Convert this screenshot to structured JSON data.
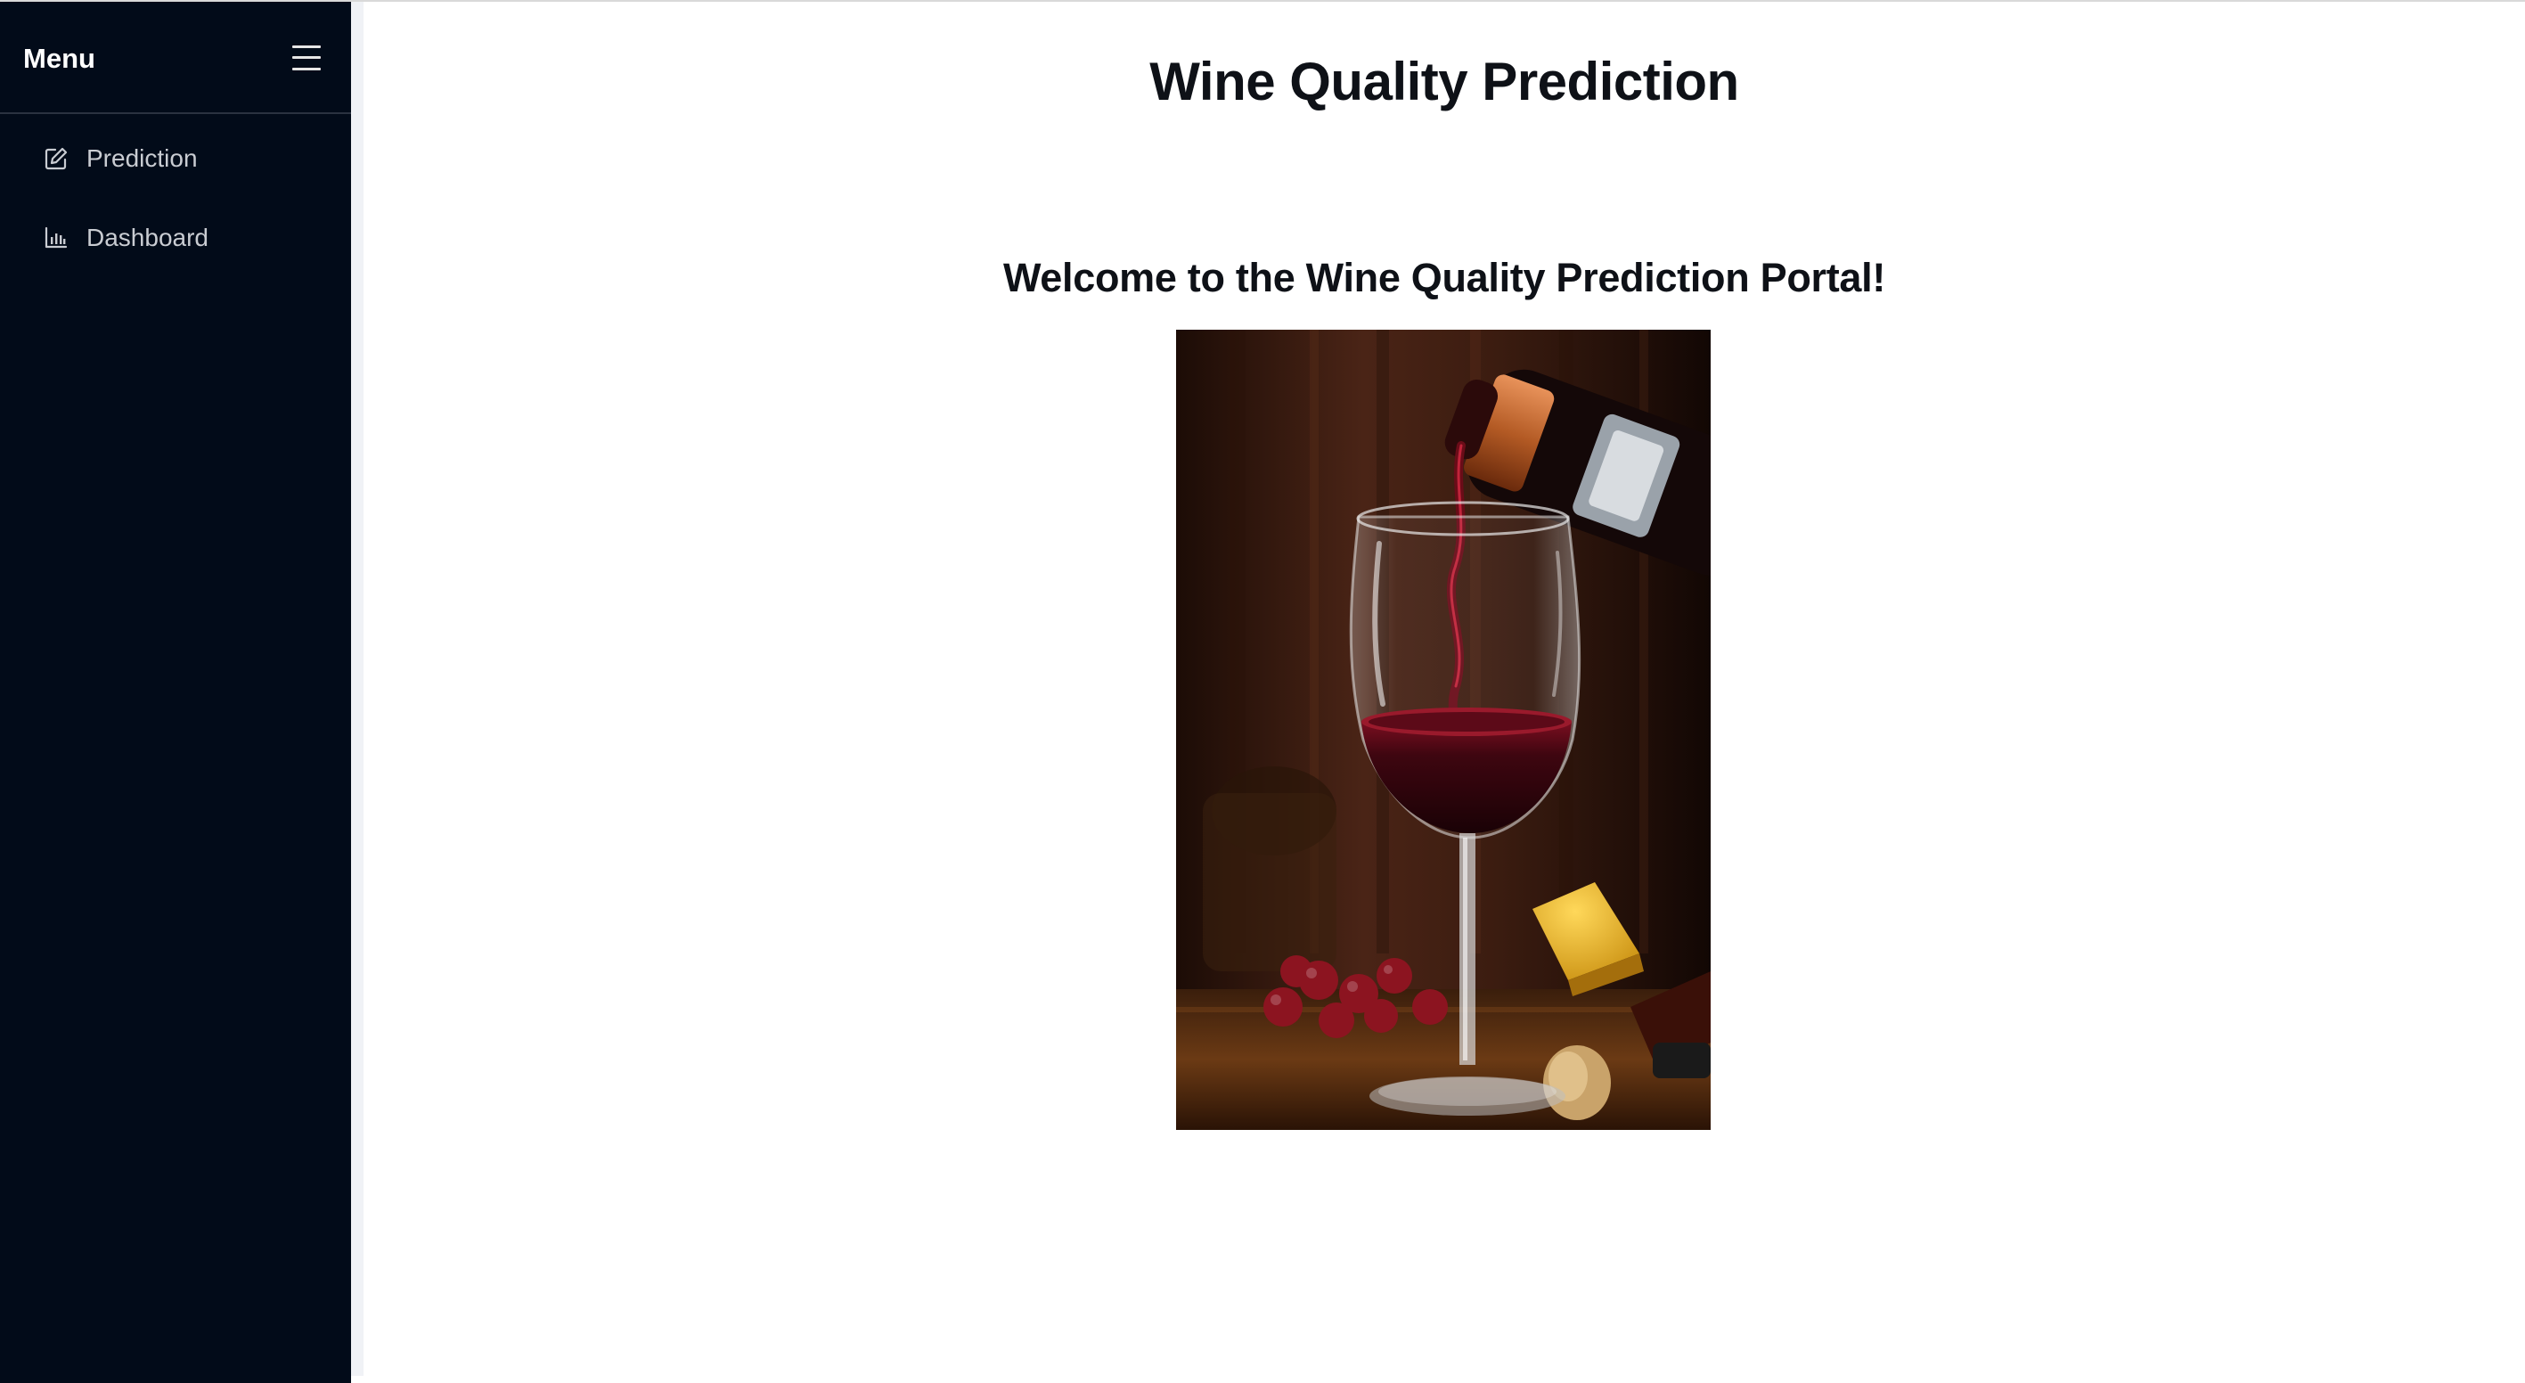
{
  "sidebar": {
    "title": "Menu",
    "items": [
      {
        "label": "Prediction",
        "icon": "edit-icon"
      },
      {
        "label": "Dashboard",
        "icon": "bar-chart-icon"
      }
    ]
  },
  "main": {
    "title": "Wine Quality Prediction",
    "welcome": "Welcome to the Wine Quality Prediction Portal!",
    "image": {
      "subject": "wine-pour-photo"
    }
  },
  "colors": {
    "sidebar_bg": "#020b19",
    "sidebar_text": "#c9ccd2",
    "heading_text": "#0e1117",
    "page_bg": "#ffffff"
  }
}
